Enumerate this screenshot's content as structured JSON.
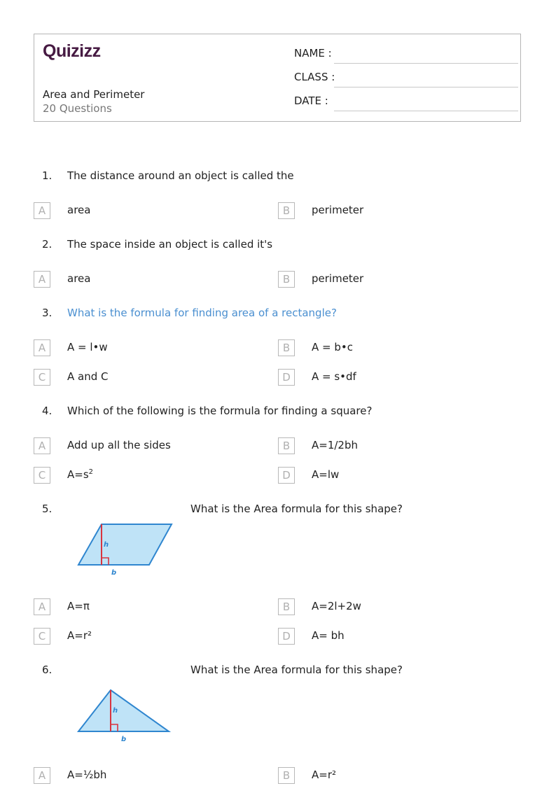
{
  "header": {
    "logo": "Quizizz",
    "title": "Area and Perimeter",
    "subtitle": "20 Questions",
    "fields": [
      "NAME :",
      "CLASS :",
      "DATE  :"
    ]
  },
  "questions": [
    {
      "number": "1.",
      "text": "The distance around an object is called the",
      "options": [
        {
          "letter": "A",
          "text": "area"
        },
        {
          "letter": "B",
          "text": "perimeter"
        }
      ]
    },
    {
      "number": "2.",
      "text": "The space inside an object is called it's",
      "options": [
        {
          "letter": "A",
          "text": "area"
        },
        {
          "letter": "B",
          "text": "perimeter"
        }
      ]
    },
    {
      "number": "3.",
      "text": "What is the formula for finding area of a rectangle?",
      "options": [
        {
          "letter": "A",
          "text": "A = l•w"
        },
        {
          "letter": "B",
          "text": "A = b•c"
        },
        {
          "letter": "C",
          "text": "A and C"
        },
        {
          "letter": "D",
          "text": "A = s•df"
        }
      ]
    },
    {
      "number": "4.",
      "text": "Which of the following is the formula for finding a square?",
      "options": [
        {
          "letter": "A",
          "text": "Add up all the sides"
        },
        {
          "letter": "B",
          "text": "A=1/2bh"
        },
        {
          "letter": "C",
          "text": "A=s",
          "sup": "2"
        },
        {
          "letter": "D",
          "text": "A=lw"
        }
      ]
    },
    {
      "number": "5.",
      "text": "What is the Area formula for this shape?",
      "figure": {
        "shape": "parallelogram",
        "labels": [
          "h",
          "b"
        ]
      },
      "options": [
        {
          "letter": "A",
          "text": "A=π"
        },
        {
          "letter": "B",
          "text": "A=2l+2w"
        },
        {
          "letter": "C",
          "text": "A=r²"
        },
        {
          "letter": "D",
          "text": "A= bh"
        }
      ]
    },
    {
      "number": "6.",
      "text": "What is the Area formula for this shape?",
      "figure": {
        "shape": "triangle",
        "labels": [
          "h",
          "b"
        ]
      },
      "options": [
        {
          "letter": "A",
          "text": "A=½bh"
        },
        {
          "letter": "B",
          "text": "A=r²"
        }
      ]
    }
  ],
  "colors": {
    "logo": "#461a42",
    "highlight": "#4a8fd0",
    "shape_fill": "#bfe3f7",
    "shape_stroke": "#2f86cf",
    "height_line": "#d9343f"
  }
}
